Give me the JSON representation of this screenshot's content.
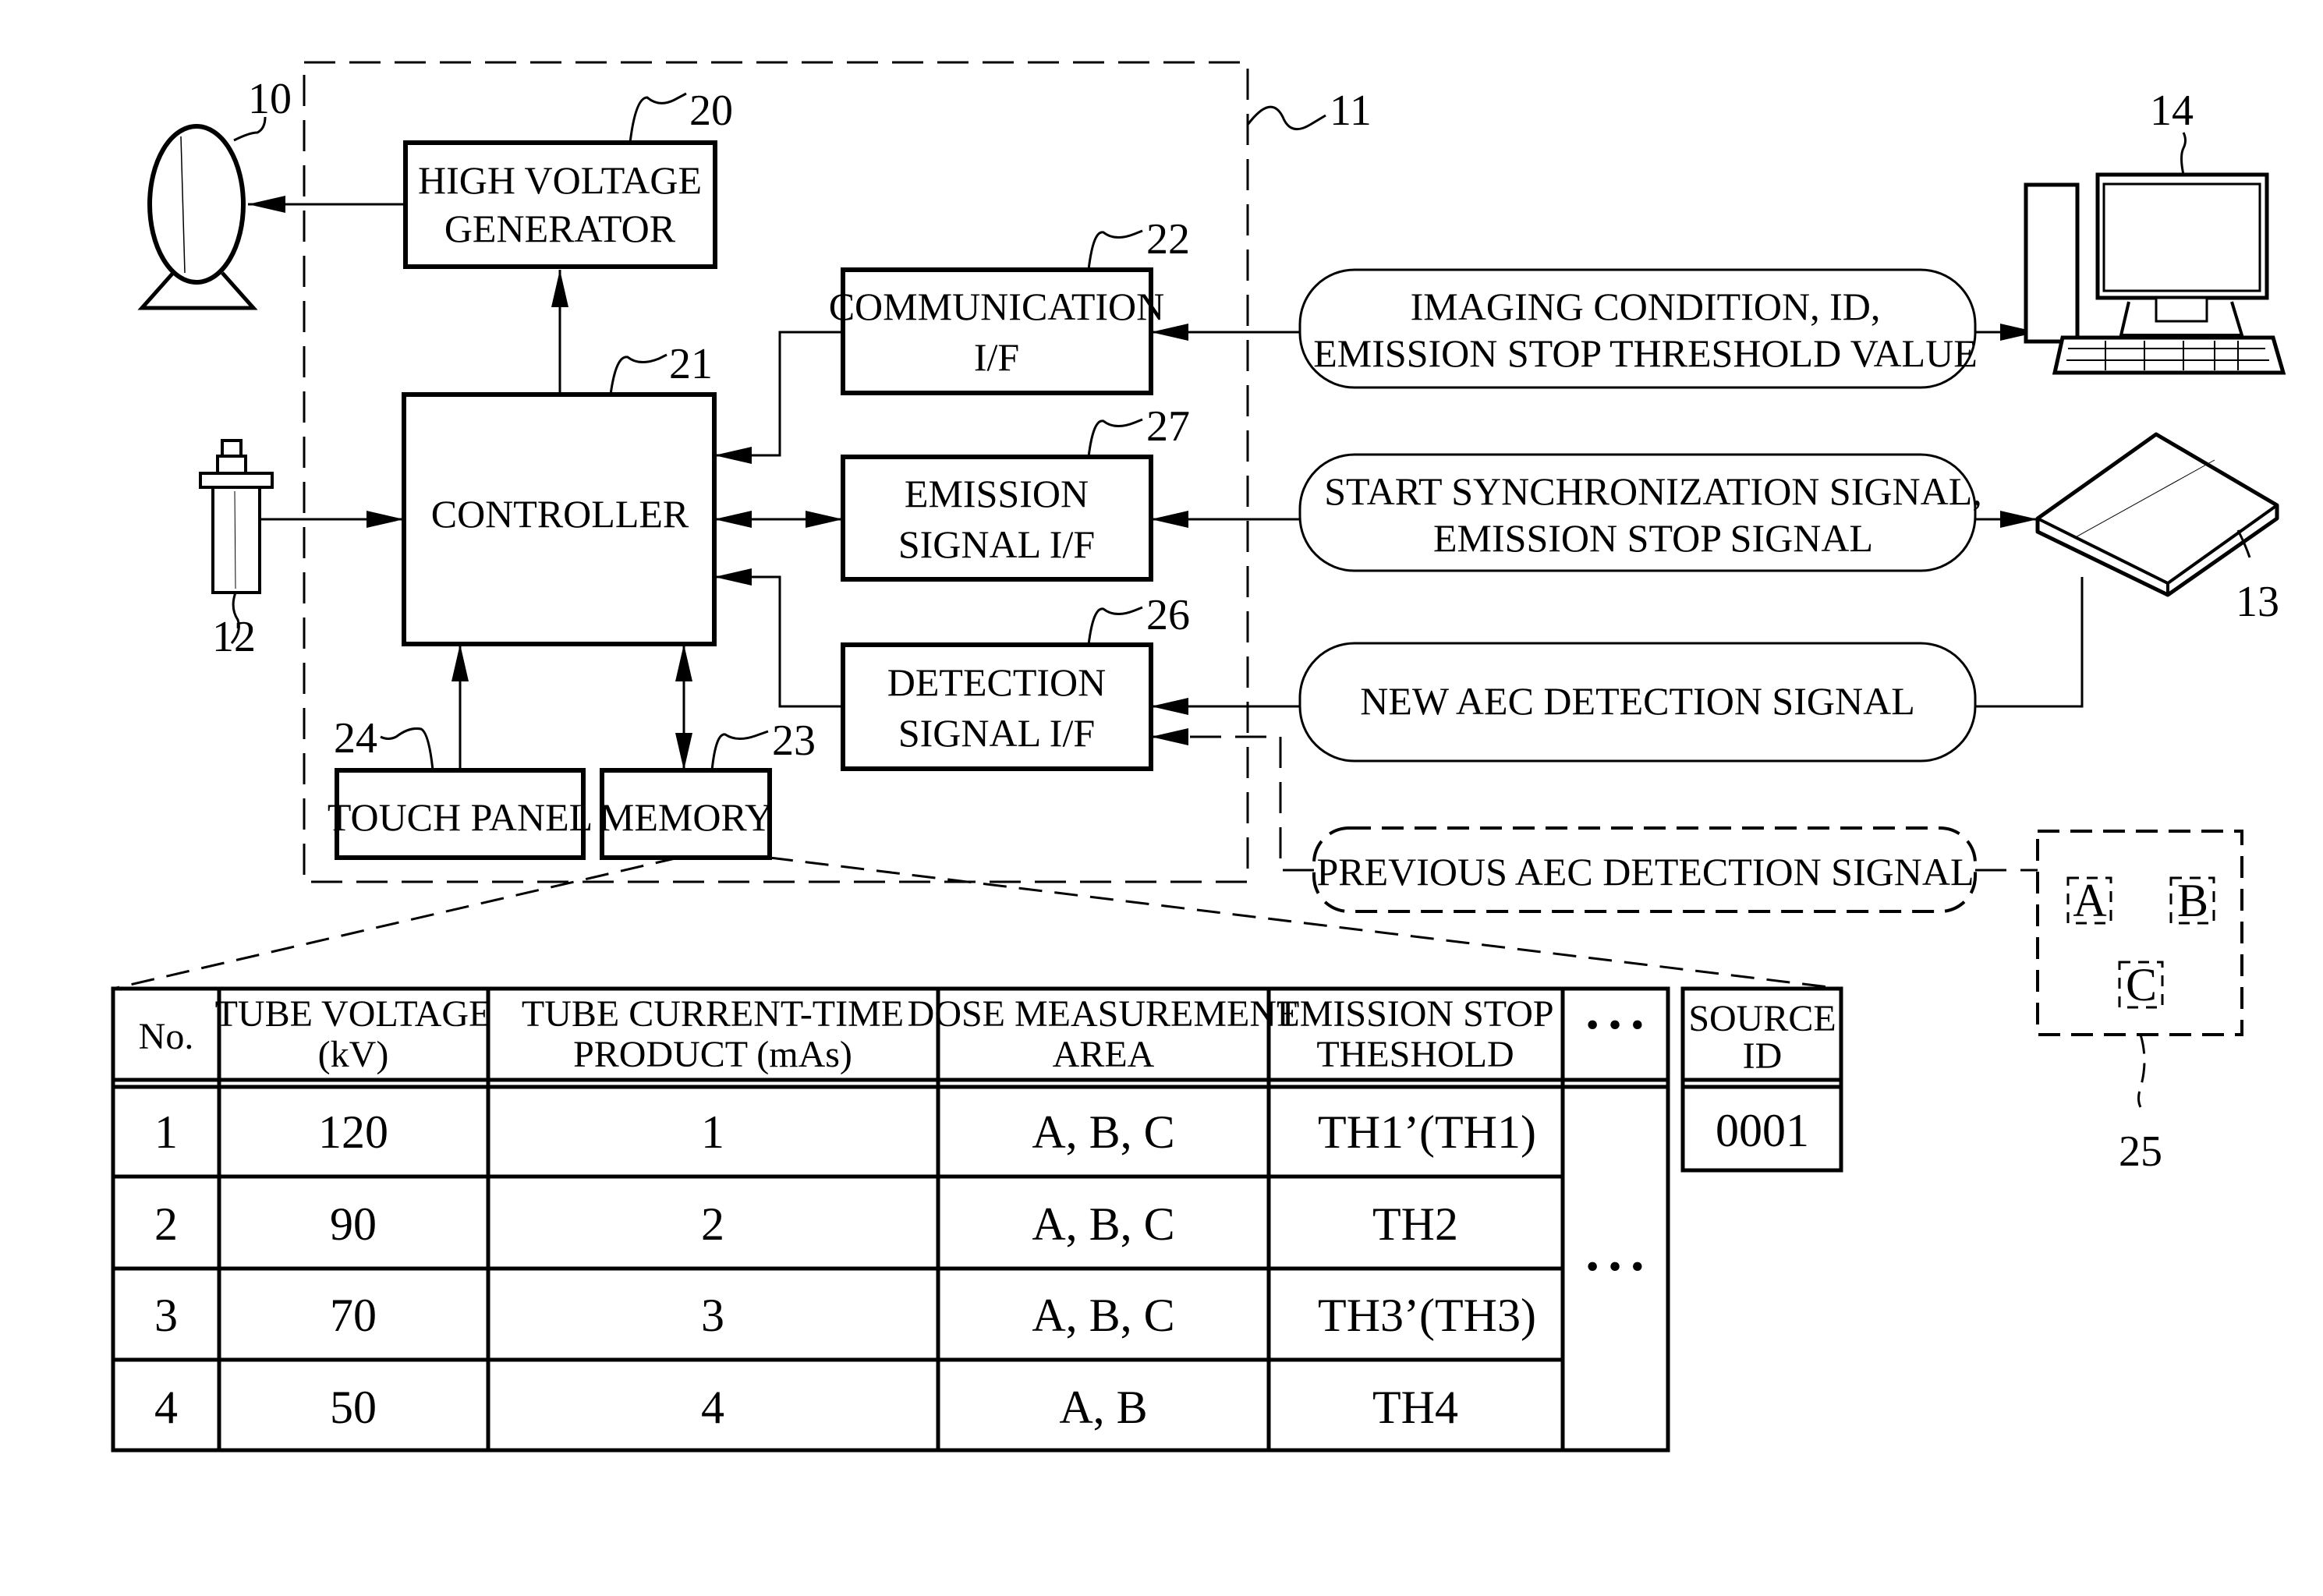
{
  "figure": {
    "blocks": {
      "high_voltage_generator": {
        "line1": "HIGH VOLTAGE",
        "line2": "GENERATOR",
        "ref": "20"
      },
      "controller": {
        "label": "CONTROLLER",
        "ref": "21"
      },
      "communication_if": {
        "line1": "COMMUNICATION",
        "line2": "I/F",
        "ref": "22"
      },
      "emission_signal_if": {
        "line1": "EMISSION",
        "line2": "SIGNAL I/F",
        "ref": "27"
      },
      "detection_signal_if": {
        "line1": "DETECTION",
        "line2": "SIGNAL I/F",
        "ref": "26"
      },
      "touch_panel": {
        "label": "TOUCH PANEL",
        "ref": "24"
      },
      "memory": {
        "label": "MEMORY",
        "ref": "23"
      }
    },
    "devices": {
      "xray_source": {
        "ref": "10"
      },
      "source_control_device": {
        "ref": "11"
      },
      "emission_switch": {
        "ref": "12"
      },
      "electronic_cassette": {
        "ref": "13"
      },
      "console": {
        "ref": "14"
      },
      "aec_areas": {
        "ref": "25",
        "areas": [
          "A",
          "B",
          "C"
        ]
      }
    },
    "signals": {
      "imaging_condition": {
        "line1": "IMAGING CONDITION, ID,",
        "line2": "EMISSION STOP THRESHOLD VALUE"
      },
      "start_sync": {
        "line1": "START SYNCHRONIZATION SIGNAL,",
        "line2": "EMISSION STOP SIGNAL"
      },
      "new_aec": {
        "label": "NEW AEC DETECTION SIGNAL"
      },
      "previous_aec": {
        "label": "PREVIOUS AEC DETECTION SIGNAL"
      }
    },
    "table": {
      "headers": [
        {
          "line1": "No.",
          "line2": ""
        },
        {
          "line1": "TUBE VOLTAGE",
          "line2": "(kV)"
        },
        {
          "line1": "TUBE CURRENT-TIME",
          "line2": "PRODUCT (mAs)"
        },
        {
          "line1": "DOSE MEASUREMENT",
          "line2": "AREA"
        },
        {
          "line1": "EMISSION STOP",
          "line2": "THESHOLD"
        },
        {
          "line1": "• • •",
          "line2": ""
        }
      ],
      "rows": [
        [
          "1",
          "120",
          "1",
          "A, B, C",
          "TH1’(TH1)"
        ],
        [
          "2",
          "90",
          "2",
          "A, B, C",
          "TH2"
        ],
        [
          "3",
          "70",
          "3",
          "A, B, C",
          "TH3’(TH3)"
        ],
        [
          "4",
          "50",
          "4",
          "A, B",
          "TH4"
        ]
      ],
      "ellipsis": "• • •",
      "source_id": {
        "header1": "SOURCE",
        "header2": "ID",
        "value": "0001"
      }
    }
  }
}
